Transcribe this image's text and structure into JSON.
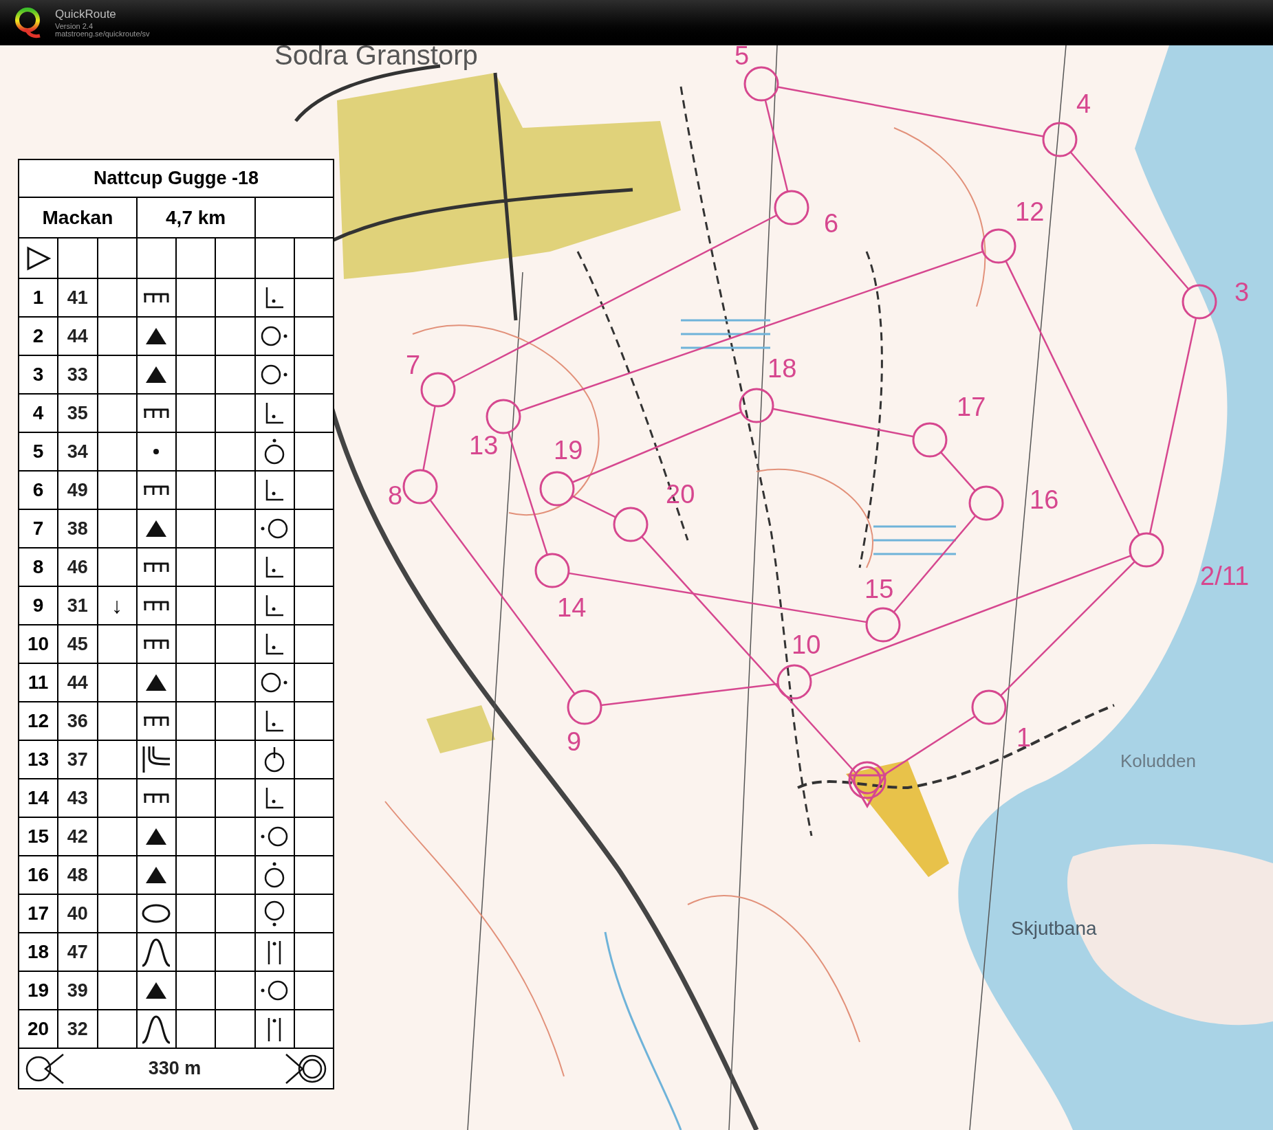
{
  "app": {
    "title": "QuickRoute",
    "version": "Version 2.4",
    "url": "matstroeng.se/quickroute/sv"
  },
  "map": {
    "place_names": [
      "Sodra Granstorp",
      "Koludden",
      "Skjutbana"
    ],
    "controls": [
      {
        "label": "1"
      },
      {
        "label": "2/11"
      },
      {
        "label": "3"
      },
      {
        "label": "4"
      },
      {
        "label": "5"
      },
      {
        "label": "6"
      },
      {
        "label": "7"
      },
      {
        "label": "8"
      },
      {
        "label": "9"
      },
      {
        "label": "10"
      },
      {
        "label": "12"
      },
      {
        "label": "13"
      },
      {
        "label": "14"
      },
      {
        "label": "15"
      },
      {
        "label": "16"
      },
      {
        "label": "17"
      },
      {
        "label": "18"
      },
      {
        "label": "19"
      },
      {
        "label": "20"
      }
    ]
  },
  "description_sheet": {
    "title": "Nattcup Gugge -18",
    "course": "Mackan",
    "length": "4,7 km",
    "rows": [
      {
        "number": "1",
        "code": "41",
        "feature": {
          "kind": "ticks"
        },
        "position": {
          "kind": "corner"
        }
      },
      {
        "number": "2",
        "code": "44",
        "feature": {
          "kind": "triangle"
        },
        "position": {
          "kind": "dot-right"
        }
      },
      {
        "number": "3",
        "code": "33",
        "feature": {
          "kind": "triangle"
        },
        "position": {
          "kind": "dot-right"
        }
      },
      {
        "number": "4",
        "code": "35",
        "feature": {
          "kind": "ticks"
        },
        "position": {
          "kind": "corner"
        }
      },
      {
        "number": "5",
        "code": "34",
        "feature": {
          "kind": "dot"
        },
        "position": {
          "kind": "dot-above"
        }
      },
      {
        "number": "6",
        "code": "49",
        "feature": {
          "kind": "ticks"
        },
        "position": {
          "kind": "corner"
        }
      },
      {
        "number": "7",
        "code": "38",
        "feature": {
          "kind": "triangle"
        },
        "position": {
          "kind": "dot-left"
        }
      },
      {
        "number": "8",
        "code": "46",
        "feature": {
          "kind": "ticks"
        },
        "position": {
          "kind": "corner"
        }
      },
      {
        "number": "9",
        "code": "31",
        "direction": "↓",
        "feature": {
          "kind": "ticks"
        },
        "position": {
          "kind": "corner"
        }
      },
      {
        "number": "10",
        "code": "45",
        "feature": {
          "kind": "ticks"
        },
        "position": {
          "kind": "corner"
        }
      },
      {
        "number": "11",
        "code": "44",
        "feature": {
          "kind": "triangle"
        },
        "position": {
          "kind": "dot-right"
        }
      },
      {
        "number": "12",
        "code": "36",
        "feature": {
          "kind": "ticks"
        },
        "position": {
          "kind": "corner"
        }
      },
      {
        "number": "13",
        "code": "37",
        "feature": {
          "kind": "split"
        },
        "position": {
          "kind": "line-above"
        }
      },
      {
        "number": "14",
        "code": "43",
        "feature": {
          "kind": "ticks"
        },
        "position": {
          "kind": "corner"
        }
      },
      {
        "number": "15",
        "code": "42",
        "feature": {
          "kind": "triangle"
        },
        "position": {
          "kind": "dot-left"
        }
      },
      {
        "number": "16",
        "code": "48",
        "feature": {
          "kind": "triangle"
        },
        "position": {
          "kind": "dot-above"
        }
      },
      {
        "number": "17",
        "code": "40",
        "feature": {
          "kind": "ellipse"
        },
        "position": {
          "kind": "dot-below"
        }
      },
      {
        "number": "18",
        "code": "47",
        "feature": {
          "kind": "bell"
        },
        "position": {
          "kind": "dot-between"
        }
      },
      {
        "number": "19",
        "code": "39",
        "feature": {
          "kind": "triangle"
        },
        "position": {
          "kind": "dot-left"
        }
      },
      {
        "number": "20",
        "code": "32",
        "feature": {
          "kind": "bell"
        },
        "position": {
          "kind": "dot-between"
        }
      }
    ],
    "footer": "330 m"
  }
}
